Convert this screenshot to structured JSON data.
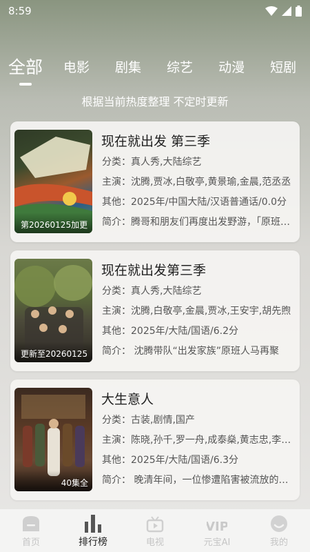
{
  "status_bar": {
    "time": "8:59"
  },
  "tabs": [
    {
      "label": "全部",
      "active": true
    },
    {
      "label": "电影"
    },
    {
      "label": "剧集"
    },
    {
      "label": "综艺"
    },
    {
      "label": "动漫"
    },
    {
      "label": "短剧"
    }
  ],
  "subtitle": "根据当前热度整理 不定时更新",
  "cards": [
    {
      "title": "现在就出发 第三季",
      "badge": "第20260125加更",
      "category": "分类：真人秀,大陆综艺",
      "cast": "主演：沈腾,贾冰,白敬亭,黄景瑜,金晨,范丞丞",
      "other": "其他：2025年/中国大陆/汉语普通话/0.0分",
      "intro": "简介：腾哥和朋友们再度出发野游，「原班人马」"
    },
    {
      "title": "现在就出发第三季",
      "badge": "更新至20260125",
      "category": "分类：真人秀,大陆综艺",
      "cast": "主演：沈腾,白敬亭,金晨,贾冰,王安宇,胡先煦",
      "other": "其他：2025年/大陆/国语/6.2分",
      "intro": "简介：      沈腾带队“出发家族”原班人马再聚"
    },
    {
      "title": "大生意人",
      "badge": "40集全",
      "category": "分类：古装,剧情,国产",
      "cast": "主演：陈晓,孙千,罗一舟,成泰燊,黄志忠,李乃文",
      "other": "其他：2025年/大陆/国语/6.3分",
      "intro": "简介：      晚清年间，一位惨遭陷害被流放的商人"
    }
  ],
  "bottom_nav": [
    {
      "label": "首页",
      "icon": "home-icon"
    },
    {
      "label": "排行榜",
      "icon": "ranking-icon",
      "active": true
    },
    {
      "label": "电视",
      "icon": "tv-icon"
    },
    {
      "label": "元宝AI",
      "icon": "vip-icon"
    },
    {
      "label": "我的",
      "icon": "profile-icon"
    }
  ]
}
